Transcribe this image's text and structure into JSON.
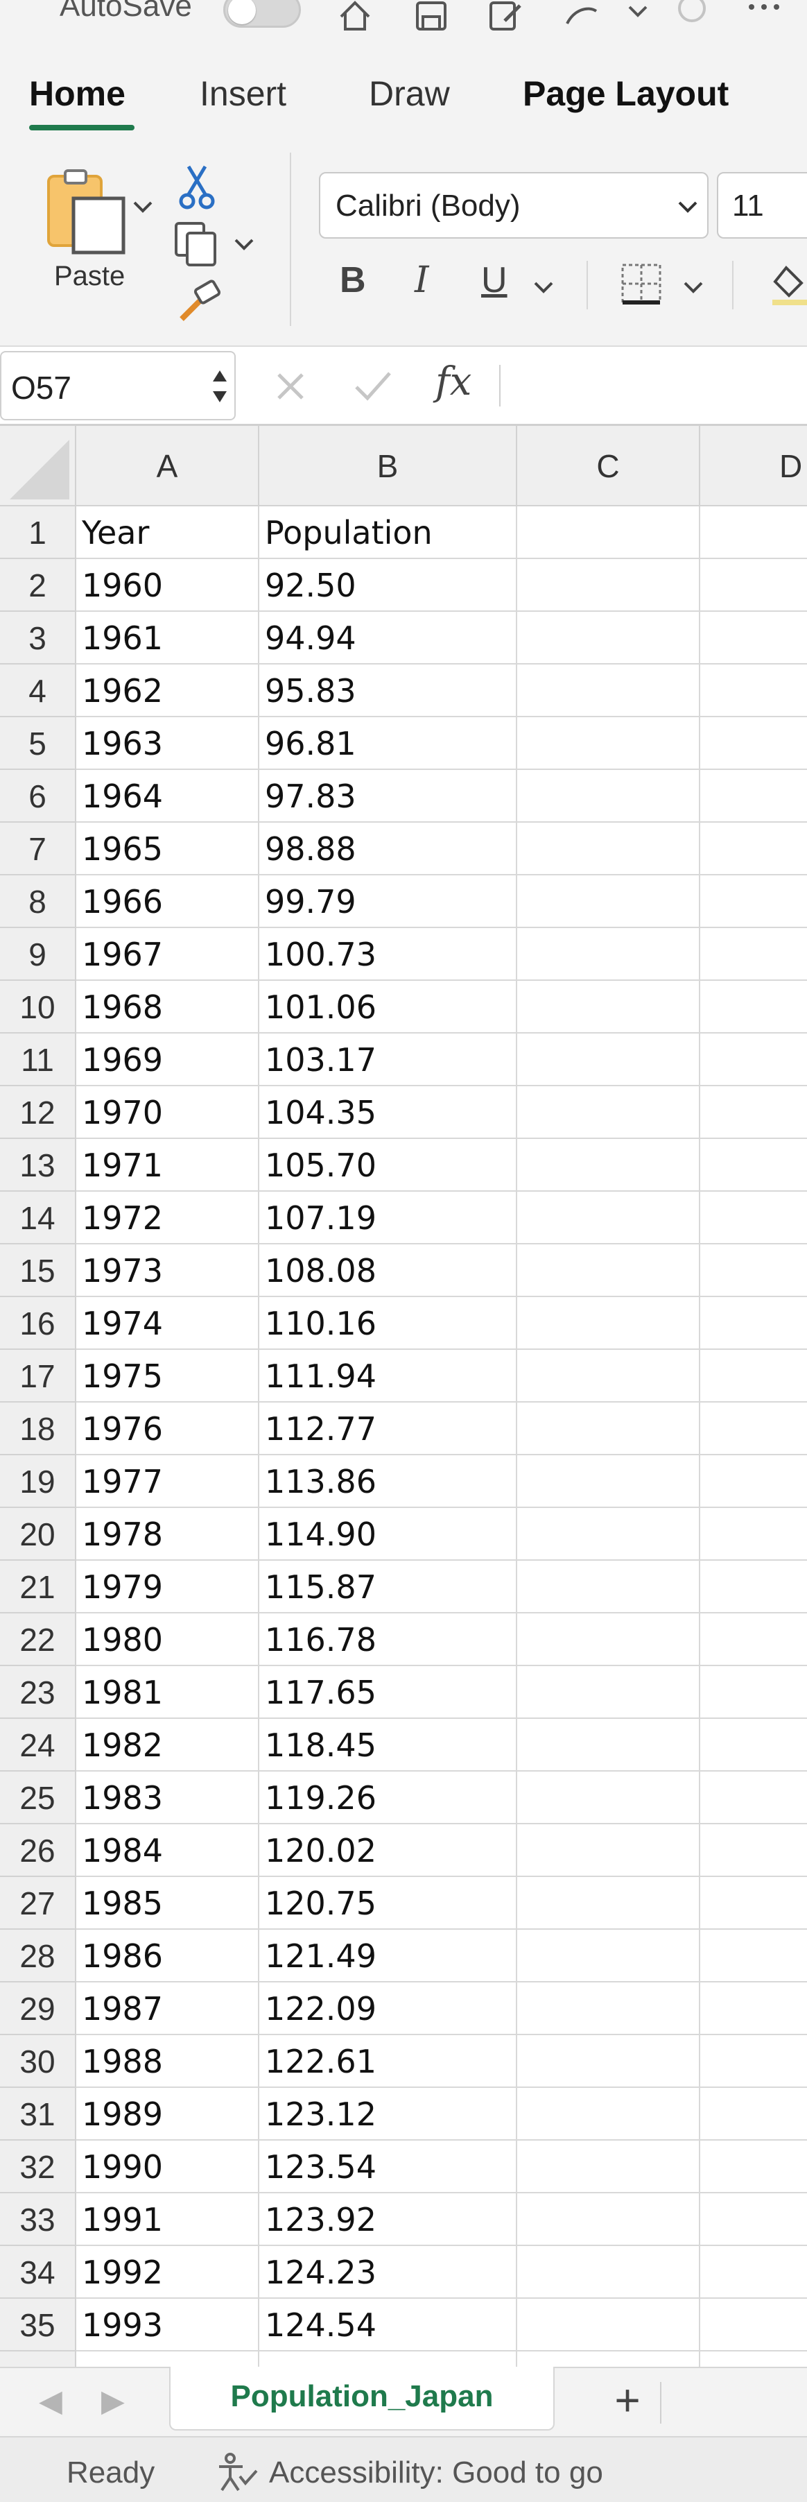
{
  "app": {
    "autosave_label": "AutoSave",
    "colors": {
      "accent": "#1f7a4c",
      "ribbon_bg": "#f3f3f3",
      "header_bg": "#efefef"
    }
  },
  "ribbon": {
    "tabs": [
      {
        "label": "Home",
        "active": true
      },
      {
        "label": "Insert",
        "active": false
      },
      {
        "label": "Draw",
        "active": false
      },
      {
        "label": "Page Layout",
        "active": false
      }
    ],
    "paste_label": "Paste",
    "font_name": "Calibri (Body)",
    "font_size": "11",
    "bold_label": "B",
    "italic_label": "I",
    "underline_label": "U"
  },
  "formula_bar": {
    "name_box": "O57",
    "fx_label": "fx",
    "formula": ""
  },
  "sheet": {
    "columns": [
      "A",
      "B",
      "C",
      "D"
    ],
    "rows": [
      {
        "n": "1",
        "a": "Year",
        "b": "Population"
      },
      {
        "n": "2",
        "a": "1960",
        "b": "92.50"
      },
      {
        "n": "3",
        "a": "1961",
        "b": "94.94"
      },
      {
        "n": "4",
        "a": "1962",
        "b": "95.83"
      },
      {
        "n": "5",
        "a": "1963",
        "b": "96.81"
      },
      {
        "n": "6",
        "a": "1964",
        "b": "97.83"
      },
      {
        "n": "7",
        "a": "1965",
        "b": "98.88"
      },
      {
        "n": "8",
        "a": "1966",
        "b": "99.79"
      },
      {
        "n": "9",
        "a": "1967",
        "b": "100.73"
      },
      {
        "n": "10",
        "a": "1968",
        "b": "101.06"
      },
      {
        "n": "11",
        "a": "1969",
        "b": "103.17"
      },
      {
        "n": "12",
        "a": "1970",
        "b": "104.35"
      },
      {
        "n": "13",
        "a": "1971",
        "b": "105.70"
      },
      {
        "n": "14",
        "a": "1972",
        "b": "107.19"
      },
      {
        "n": "15",
        "a": "1973",
        "b": "108.08"
      },
      {
        "n": "16",
        "a": "1974",
        "b": "110.16"
      },
      {
        "n": "17",
        "a": "1975",
        "b": "111.94"
      },
      {
        "n": "18",
        "a": "1976",
        "b": "112.77"
      },
      {
        "n": "19",
        "a": "1977",
        "b": "113.86"
      },
      {
        "n": "20",
        "a": "1978",
        "b": "114.90"
      },
      {
        "n": "21",
        "a": "1979",
        "b": "115.87"
      },
      {
        "n": "22",
        "a": "1980",
        "b": "116.78"
      },
      {
        "n": "23",
        "a": "1981",
        "b": "117.65"
      },
      {
        "n": "24",
        "a": "1982",
        "b": "118.45"
      },
      {
        "n": "25",
        "a": "1983",
        "b": "119.26"
      },
      {
        "n": "26",
        "a": "1984",
        "b": "120.02"
      },
      {
        "n": "27",
        "a": "1985",
        "b": "120.75"
      },
      {
        "n": "28",
        "a": "1986",
        "b": "121.49"
      },
      {
        "n": "29",
        "a": "1987",
        "b": "122.09"
      },
      {
        "n": "30",
        "a": "1988",
        "b": "122.61"
      },
      {
        "n": "31",
        "a": "1989",
        "b": "123.12"
      },
      {
        "n": "32",
        "a": "1990",
        "b": "123.54"
      },
      {
        "n": "33",
        "a": "1991",
        "b": "123.92"
      },
      {
        "n": "34",
        "a": "1992",
        "b": "124.23"
      },
      {
        "n": "35",
        "a": "1993",
        "b": "124.54"
      }
    ],
    "tab_name": "Population_Japan",
    "add_sheet_label": "+"
  },
  "status": {
    "ready": "Ready",
    "accessibility": "Accessibility: Good to go"
  }
}
